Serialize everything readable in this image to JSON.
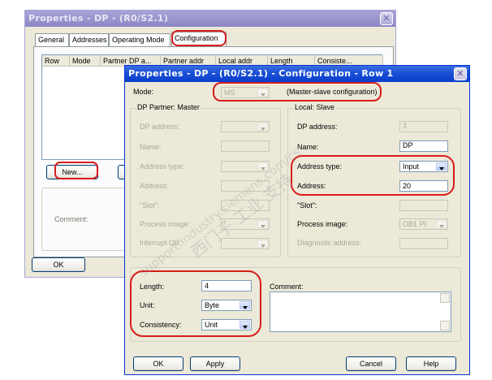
{
  "back_window": {
    "title": "Properties - DP - (R0/S2.1)",
    "tabs": [
      "General",
      "Addresses",
      "Operating Mode",
      "Configuration"
    ],
    "columns": [
      "Row",
      "Mode",
      "Partner DP a...",
      "Partner addr",
      "Local addr",
      "Length",
      "Consiste..."
    ],
    "new_button": "New...",
    "comment_label": "Comment:",
    "ok_button": "OK"
  },
  "front_window": {
    "title": "Properties - DP - (R0/S2.1) - Configuration - Row 1",
    "mode_label": "Mode:",
    "mode_value": "MS",
    "mode_description": "(Master-slave configuration)",
    "partner_group": {
      "title": "DP Partner: Master",
      "dp_address": "DP address:",
      "name": "Name:",
      "address_type": "Address type:",
      "address": "Address:",
      "slot": "\"Slot\":",
      "process_image": "Process image:",
      "interrupt_ob": "Interrupt OB:"
    },
    "local_group": {
      "title": "Local: Slave",
      "dp_address_label": "DP address:",
      "dp_address_value": "3",
      "name_label": "Name:",
      "name_value": "DP",
      "address_type_label": "Address type:",
      "address_type_value": "Input",
      "address_label": "Address:",
      "address_value": "20",
      "slot_label": "\"Slot\":",
      "process_image_label": "Process image:",
      "process_image_value": "OB1 PI",
      "diagnostic_label": "Diagnostic address:"
    },
    "length_label": "Length:",
    "length_value": "4",
    "unit_label": "Unit:",
    "unit_value": "Byte",
    "consistency_label": "Consistency:",
    "consistency_value": "Unit",
    "comment_label": "Comment:",
    "buttons": {
      "ok": "OK",
      "apply": "Apply",
      "cancel": "Cancel",
      "help": "Help"
    }
  },
  "watermark": "support.industry.siemens.com/cs",
  "watermark_cjk": "西门子 工业 支持",
  "colors": {
    "annotation": "#d81c1c",
    "titlebar_active": "#1a4fd6",
    "dialog_bg": "#ece9d8"
  }
}
